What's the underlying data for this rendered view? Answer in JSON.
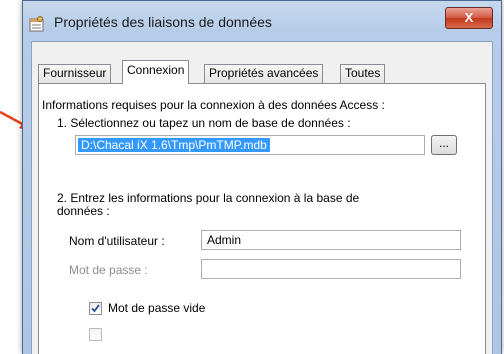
{
  "window": {
    "title": "Propriétés des liaisons de données",
    "close_label": "X"
  },
  "tabs": [
    {
      "label": "Fournisseur"
    },
    {
      "label": "Connexion"
    },
    {
      "label": "Propriétés avancées"
    },
    {
      "label": "Toutes"
    }
  ],
  "connection": {
    "intro": "Informations requises pour la connexion à des données Access :",
    "step1": "1. Sélectionnez ou tapez un nom de base de données :",
    "db_path": "D:\\Chacal iX 1.6\\Tmp\\PmTMP.mdb",
    "browse_label": "...",
    "step2_line1": "2. Entrez les informations pour la connexion à la base de",
    "step2_line2": "données :",
    "username_label": "Nom d'utilisateur :",
    "username_value": "Admin",
    "password_label": "Mot de passe :",
    "password_value": "",
    "blank_password_label": "Mot de passe vide",
    "blank_password_checked": true
  },
  "colors": {
    "selection": "#3399ff",
    "arrow": "#e8401c"
  }
}
